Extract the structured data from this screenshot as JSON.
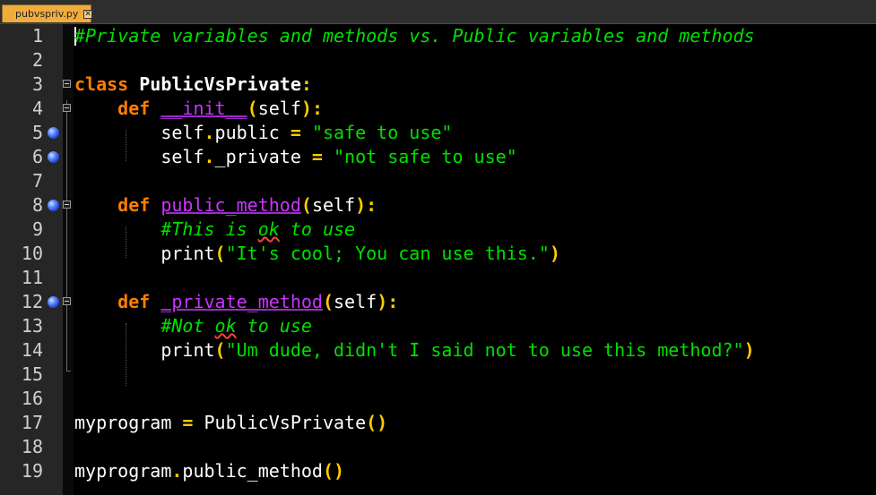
{
  "tab": {
    "filename": "pubvspriv.py",
    "close_glyph": "✕"
  },
  "line_numbers": [
    "1",
    "2",
    "3",
    "4",
    "5",
    "6",
    "7",
    "8",
    "9",
    "10",
    "11",
    "12",
    "13",
    "14",
    "15",
    "16",
    "17",
    "18",
    "19"
  ],
  "code": {
    "l1": {
      "comment": "#Private variables and methods vs. Public variables and methods"
    },
    "l3": {
      "kw": "class",
      "sp": " ",
      "name": "PublicVsPrivate",
      "colon": ":"
    },
    "l4": {
      "indent": "    ",
      "kw": "def",
      "sp": " ",
      "name": "__init__",
      "p1": "(",
      "arg": "self",
      "p2": ")",
      "colon": ":"
    },
    "l5": {
      "indent": "        ",
      "obj": "self",
      "dot": ".",
      "attr": "public",
      "sp": " ",
      "eq": "=",
      "sp2": " ",
      "str": "\"safe to use\""
    },
    "l6": {
      "indent": "        ",
      "obj": "self",
      "dot": ".",
      "attr": "_private",
      "sp": " ",
      "eq": "=",
      "sp2": " ",
      "str": "\"not safe to use\""
    },
    "l8": {
      "indent": "    ",
      "kw": "def",
      "sp": " ",
      "name": "public_method",
      "p1": "(",
      "arg": "self",
      "p2": ")",
      "colon": ":"
    },
    "l9": {
      "indent": "        ",
      "c1": "#This is ",
      "c2": "ok",
      "c3": " to use"
    },
    "l10": {
      "indent": "        ",
      "fn": "print",
      "p1": "(",
      "str": "\"It's cool; You can use this.\"",
      "p2": ")"
    },
    "l12": {
      "indent": "    ",
      "kw": "def",
      "sp": " ",
      "name": "_private_method",
      "p1": "(",
      "arg": "self",
      "p2": ")",
      "colon": ":"
    },
    "l13": {
      "indent": "        ",
      "c1": "#Not ",
      "c2": "ok",
      "c3": " to use"
    },
    "l14": {
      "indent": "        ",
      "fn": "print",
      "p1": "(",
      "str": "\"Um dude, didn't I said not to use this method?\"",
      "p2": ")"
    },
    "l17": {
      "var": "myprogram",
      "sp": " ",
      "eq": "=",
      "sp2": " ",
      "cls": "PublicVsPrivate",
      "parens": "()"
    },
    "l19": {
      "obj": "myprogram",
      "dot": ".",
      "method": "public_method",
      "parens": "()"
    }
  },
  "colors": {
    "background": "#000000",
    "gutter": "#262626",
    "comment": "#00e000",
    "keyword": "#ff7f00",
    "function_name": "#cc33ff",
    "operator": "#ffcc00",
    "string": "#00e000",
    "tab": "#f0ad3d",
    "bookmark": "#2f5bff"
  }
}
